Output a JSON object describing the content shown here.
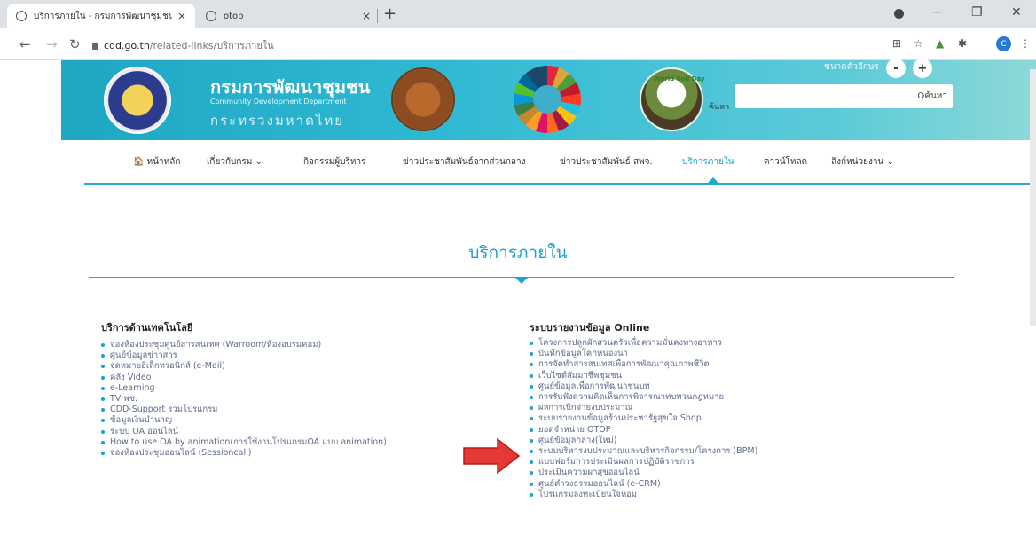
{
  "browser": {
    "tabs": [
      {
        "title": "บริการภายใน - กรมการพัฒนาชุมชน",
        "close": "×"
      },
      {
        "title": "otop",
        "close": "×"
      }
    ],
    "new_tab": "+",
    "url_host": "cdd.go.th",
    "url_path": "/related-links/บริการภายใน",
    "profile_initial": "C",
    "window": {
      "minimize": "−",
      "maximize": "❐",
      "close": "✕"
    }
  },
  "header": {
    "org_name_th": "กรมการพัฒนาชุมชน",
    "org_name_en": "Community Development Department",
    "ministry_th": "กระทรวงมหาดไทย",
    "soil_logo_text": "World Soil Day",
    "font_size_label": "ขนาดตัวอักษร",
    "font_decrease": "-",
    "font_increase": "+",
    "search_label": "ค้นหา",
    "search_placeholder": "",
    "search_button": "Qค้นหา"
  },
  "nav": {
    "items": [
      {
        "label": "🏠 หน้าหลัก"
      },
      {
        "label": "เกี่ยวกับกรม ⌄"
      },
      {
        "label": "กิจกรรมผู้บริหาร"
      },
      {
        "label": "ข่าวประชาสัมพันธ์จากส่วนกลาง"
      },
      {
        "label": "ข่าวประชาสัมพันธ์ สพจ."
      },
      {
        "label": "บริการภายใน"
      },
      {
        "label": "ดาวน์โหลด"
      },
      {
        "label": "ลิงก์หน่วยงาน ⌄"
      }
    ]
  },
  "content": {
    "page_title": "บริการภายใน",
    "left_heading": "บริการด้านเทคโนโลยี",
    "left_links": [
      "จองห้องประชุมศูนย์สารสนเทศ (Warroom/ห้องอบรมคอม)",
      "ศูนย์ข้อมูลข่าวสาร",
      "จดหมายอิเล็กทรอนิกส์ (e-Mail)",
      "คลัง Video",
      "e-Learning",
      "TV พช.",
      "CDD-Support รวมโปรแกรม",
      "ข้อมูลเงินบำนาญ",
      "ระบบ OA ออนไลน์",
      "How to use OA by animation(การใช้งานโปรแกรมOA แบบ animation)",
      "จองห้องประชุมออนไลน์ (Sessioncall)"
    ],
    "right_heading": "ระบบรายงานข้อมูล Online",
    "right_links": [
      "โครงการปลูกผักสวนครัวเพื่อความมั่นคงทางอาหาร",
      "บันทึกข้อมูลโคกหนองนา",
      "การจัดทำสารสนเทศเพื่อการพัฒนาคุณภาพชีวิต",
      "เว็บไซต์สัมมาชีพชุมชน",
      "ศูนย์ข้อมูลเพื่อการพัฒนาชนบท",
      "การรับฟังความคิดเห็นการพิจารณาทบทวนกฎหมาย",
      "ผลการเบิกจ่ายงบประมาณ",
      "ระบบรายงานข้อมูลร้านประชารัฐสุขใจ Shop",
      "ยอดจำหน่าย OTOP",
      "ศูนย์ข้อมูลกลาง(ใหม่)",
      "ระบบบริหารงบประมาณและบริหารกิจกรรม/โครงการ (BPM)",
      "แบบฟอร์มการประเมินผลการปฏิบัติราชการ",
      "ประเมินความผาสุขออนไลน์",
      "ศูนย์ดำรงธรรมออนไลน์ (e-CRM)",
      "โปรแกรมลงทะเบียนใจหอม"
    ]
  },
  "colors": {
    "header_blue": "#1da7c3",
    "accent_blue": "#1aa1d6",
    "arrow_red": "#e53935"
  }
}
